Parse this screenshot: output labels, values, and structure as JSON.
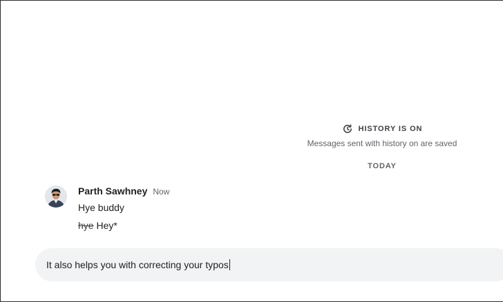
{
  "history": {
    "icon": "history-icon",
    "title": "HISTORY IS ON",
    "subtitle": "Messages sent with history on are saved"
  },
  "date_divider": "TODAY",
  "messages": [
    {
      "sender": "Parth Sawhney",
      "time": "Now",
      "avatar": "avatar",
      "lines": [
        {
          "text": "Hye buddy"
        },
        {
          "struck": "hye",
          "correction": "Hey*"
        }
      ]
    }
  ],
  "composer": {
    "value": "It also helps you with correcting your typos"
  },
  "colors": {
    "composer_bg": "#f1f3f4",
    "text_primary": "#202124",
    "text_secondary": "#5f6368"
  }
}
